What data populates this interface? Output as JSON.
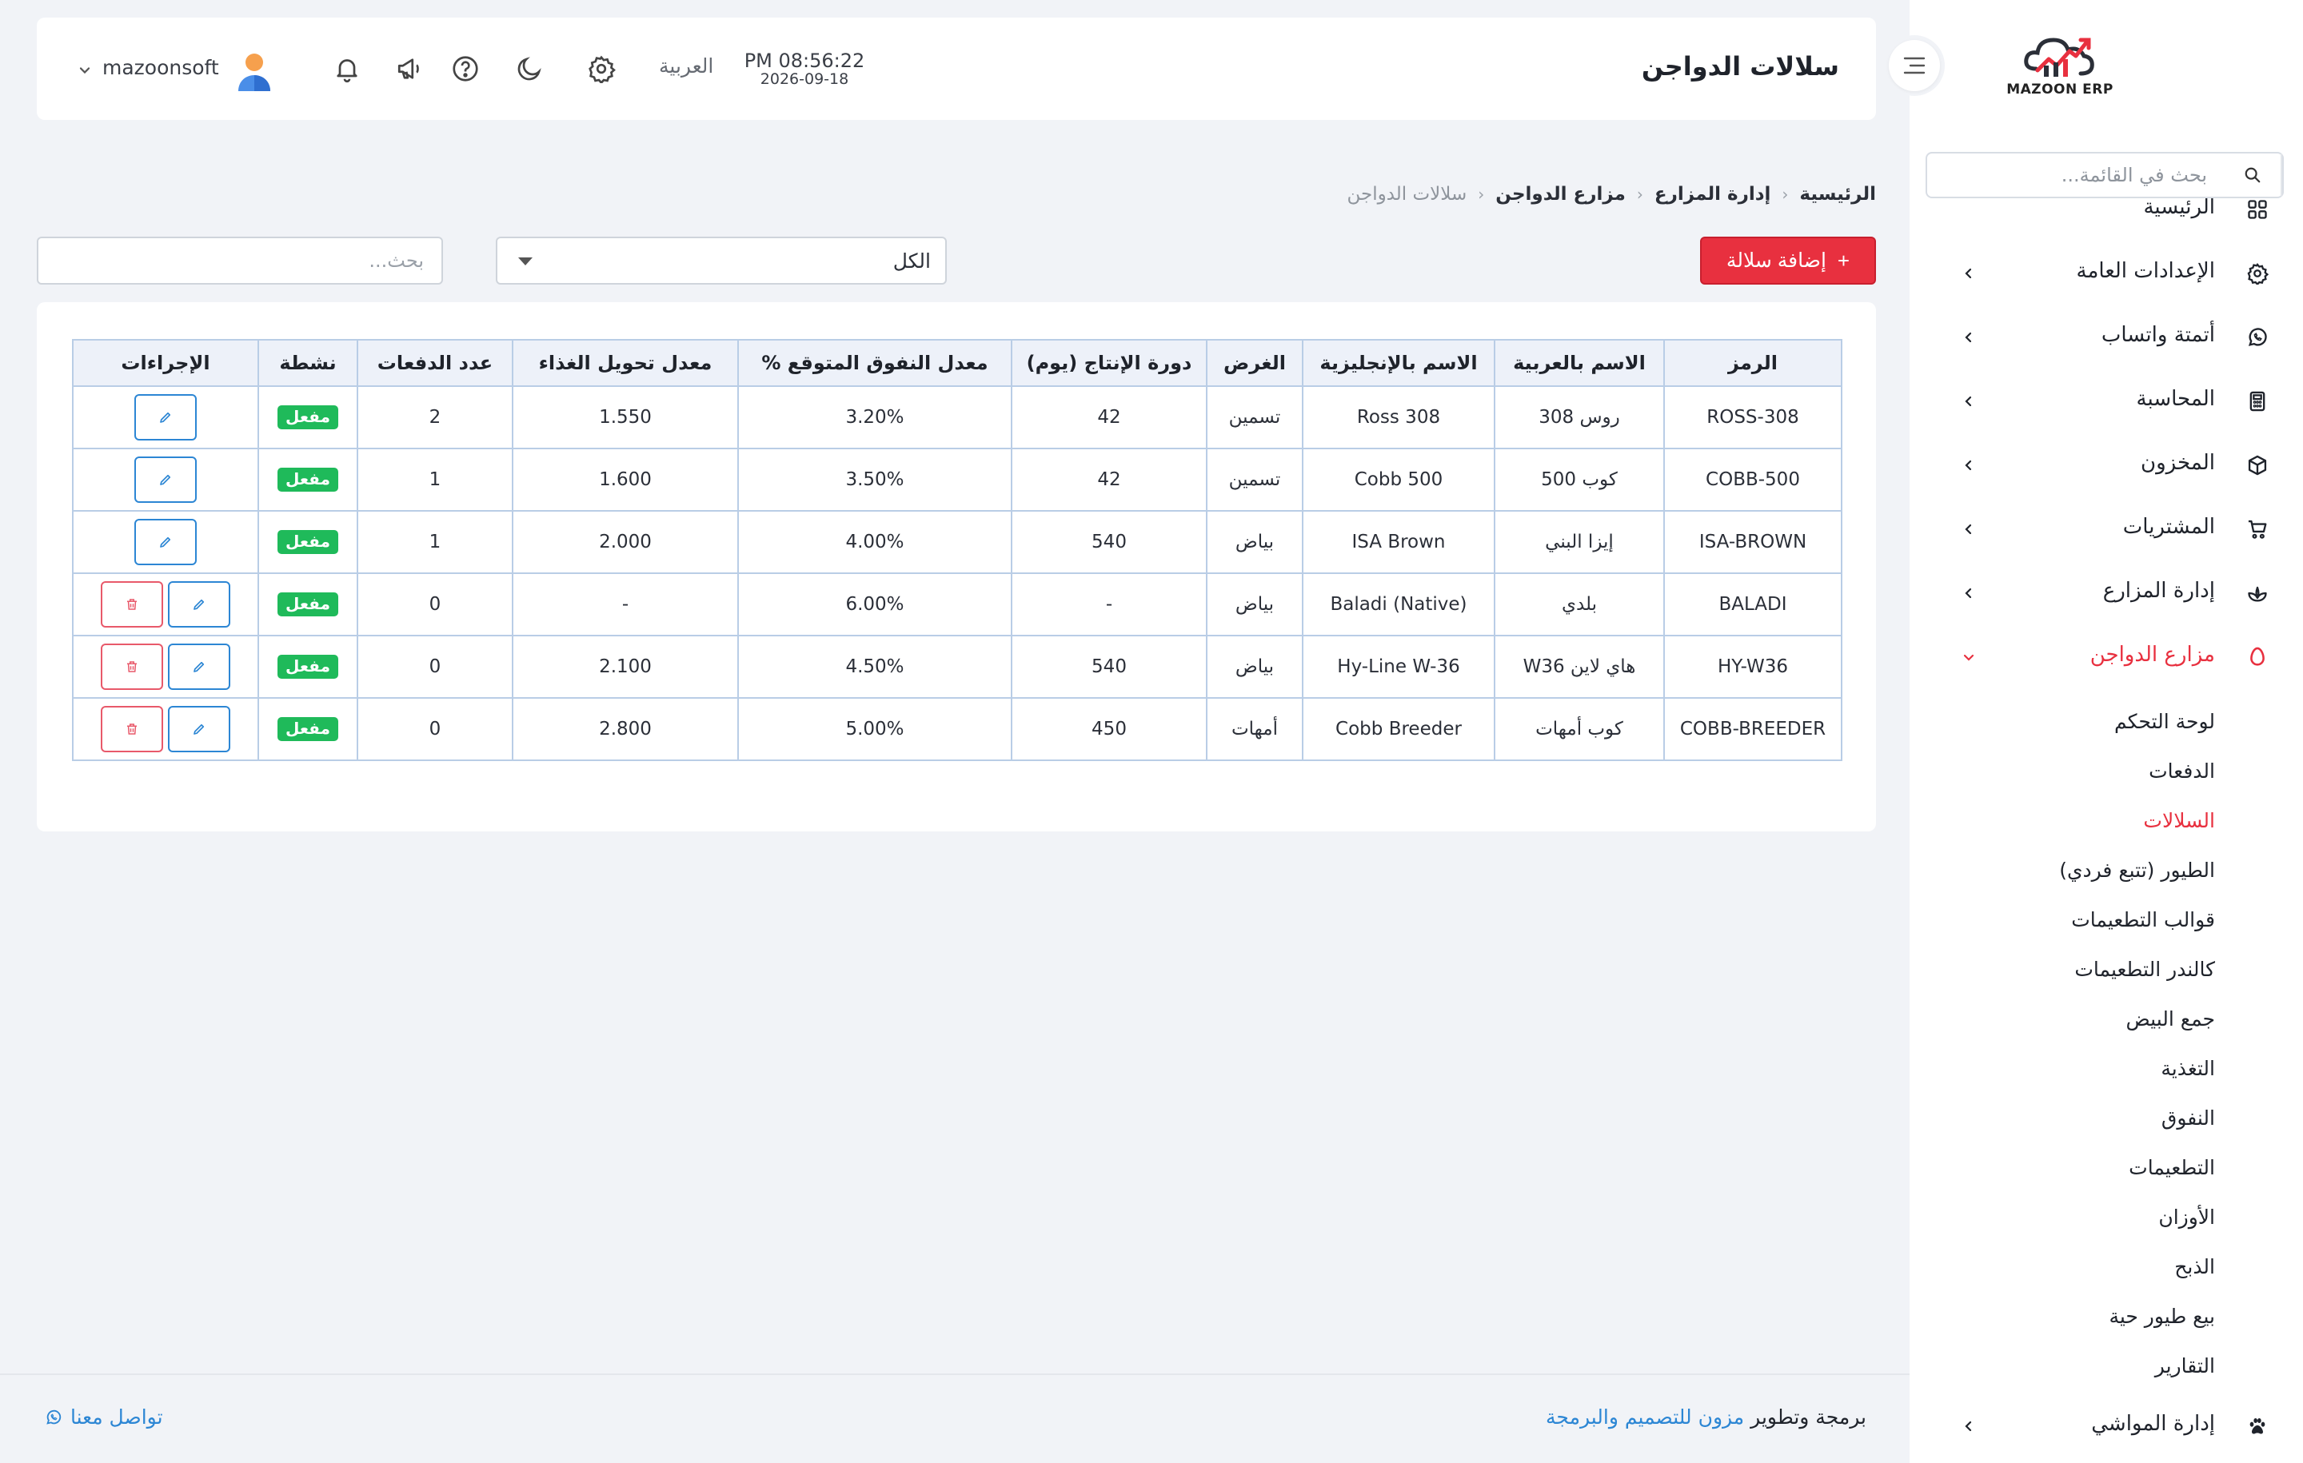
{
  "brand": {
    "logo_text": "MAZOON ERP",
    "logo_sub": "ERP"
  },
  "sidebar": {
    "search_placeholder": "بحث في القائمة...",
    "items": [
      {
        "label": "الرئيسية",
        "icon": "grid-icon",
        "has_chevron": false
      },
      {
        "label": "الإعدادات العامة",
        "icon": "gear-icon",
        "has_chevron": true
      },
      {
        "label": "أتمتة واتساب",
        "icon": "whatsapp-icon",
        "has_chevron": true
      },
      {
        "label": "المحاسبة",
        "icon": "calculator-icon",
        "has_chevron": true
      },
      {
        "label": "المخزون",
        "icon": "box-icon",
        "has_chevron": true
      },
      {
        "label": "المشتريات",
        "icon": "cart-icon",
        "has_chevron": true
      },
      {
        "label": "إدارة المزارع",
        "icon": "plant-icon",
        "has_chevron": true
      },
      {
        "label": "مزارع الدواجن",
        "icon": "egg-icon",
        "has_chevron": true,
        "active": true
      }
    ],
    "subitems": [
      {
        "label": "لوحة التحكم"
      },
      {
        "label": "الدفعات"
      },
      {
        "label": "السلالات",
        "active": true
      },
      {
        "label": "الطيور (تتبع فردي)"
      },
      {
        "label": "قوالب التطعيمات"
      },
      {
        "label": "كالندر التطعيمات"
      },
      {
        "label": "جمع البيض"
      },
      {
        "label": "التغذية"
      },
      {
        "label": "النفوق"
      },
      {
        "label": "التطعيمات"
      },
      {
        "label": "الأوزان"
      },
      {
        "label": "الذبح"
      },
      {
        "label": "بيع طيور حية"
      },
      {
        "label": "التقارير"
      }
    ],
    "last_item": {
      "label": "إدارة المواشي",
      "icon": "paw-icon"
    }
  },
  "header": {
    "title": "سلالات الدواجن",
    "time": "PM 08:56:22",
    "date": "2026-09-18",
    "language": "العربية",
    "user": "mazoonsoft"
  },
  "breadcrumb": [
    "الرئيسية",
    "إدارة المزارع",
    "مزارع الدواجن",
    "سلالات الدواجن"
  ],
  "toolbar": {
    "add_label": "إضافة سلالة",
    "filter_value": "الكل",
    "search_placeholder": "بحث..."
  },
  "table": {
    "headers": [
      "الرمز",
      "الاسم بالعربية",
      "الاسم بالإنجليزية",
      "الغرض",
      "دورة الإنتاج (يوم)",
      "معدل النفوق المتوقع %",
      "معدل تحويل الغذاء",
      "عدد الدفعات",
      "نشطة",
      "الإجراءات"
    ],
    "rows": [
      {
        "code": "ROSS-308",
        "name_ar": "روس 308",
        "name_en": "Ross 308",
        "purpose": "تسمين",
        "cycle": "42",
        "mortality": "3.20%",
        "fcr": "1.550",
        "batches": "2",
        "status": "مفعل",
        "can_delete": false
      },
      {
        "code": "COBB-500",
        "name_ar": "كوب 500",
        "name_en": "Cobb 500",
        "purpose": "تسمين",
        "cycle": "42",
        "mortality": "3.50%",
        "fcr": "1.600",
        "batches": "1",
        "status": "مفعل",
        "can_delete": false
      },
      {
        "code": "ISA-BROWN",
        "name_ar": "إيزا البني",
        "name_en": "ISA Brown",
        "purpose": "بياض",
        "cycle": "540",
        "mortality": "4.00%",
        "fcr": "2.000",
        "batches": "1",
        "status": "مفعل",
        "can_delete": false
      },
      {
        "code": "BALADI",
        "name_ar": "بلدي",
        "name_en": "Baladi (Native)",
        "purpose": "بياض",
        "cycle": "-",
        "mortality": "6.00%",
        "fcr": "-",
        "batches": "0",
        "status": "مفعل",
        "can_delete": true
      },
      {
        "code": "HY-W36",
        "name_ar": "هاي لاين W36",
        "name_en": "Hy-Line W-36",
        "purpose": "بياض",
        "cycle": "540",
        "mortality": "4.50%",
        "fcr": "2.100",
        "batches": "0",
        "status": "مفعل",
        "can_delete": true
      },
      {
        "code": "COBB-BREEDER",
        "name_ar": "كوب أمهات",
        "name_en": "Cobb Breeder",
        "purpose": "أمهات",
        "cycle": "450",
        "mortality": "5.00%",
        "fcr": "2.800",
        "batches": "0",
        "status": "مفعل",
        "can_delete": true
      }
    ]
  },
  "footer": {
    "credit_prefix": "برمجة وتطوير",
    "credit_brand": "مزون للتصميم والبرمجة",
    "contact": "تواصل معنا"
  },
  "colors": {
    "accent": "#e8303f",
    "link": "#2c86d4",
    "code": "#1ea7d9",
    "badge": "#1fba5a"
  }
}
